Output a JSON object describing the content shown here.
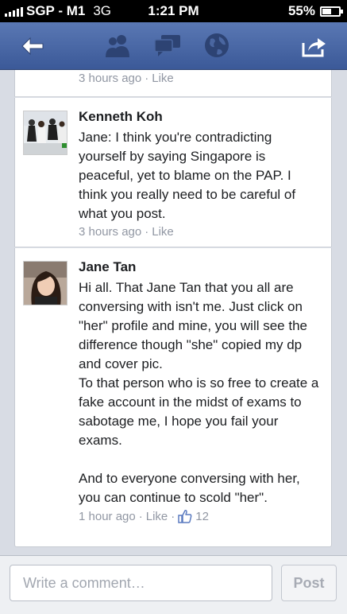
{
  "status_bar": {
    "carrier": "SGP - M1",
    "network": "3G",
    "time": "1:21 PM",
    "battery_text": "55%",
    "battery_level": 0.55
  },
  "nav": {
    "back_icon": "back-arrow-icon",
    "icons": [
      "friend-requests-icon",
      "messages-icon",
      "notifications-globe-icon"
    ],
    "share_icon": "share-icon",
    "bar_color": "#3b5998"
  },
  "top_comment": {
    "time": "3 hours ago",
    "like_label": "Like"
  },
  "comments": [
    {
      "author": "Kenneth Koh",
      "text": "Jane: I think you're contradicting yourself by saying Singapore is peaceful, yet to blame on the PAP. I think you really need to be careful of what you post.",
      "time": "3 hours ago",
      "like_label": "Like"
    },
    {
      "author": "Jane Tan",
      "text": "Hi all. That Jane Tan that you all are conversing with isn't me. Just click on \"her\" profile and mine, you will see the difference though \"she\" copied my dp and cover pic.\nTo that person who is so free to create a fake account in the midst of exams to sabotage me, I hope you fail your exams.\n\nAnd to everyone conversing with her, you can continue to scold \"her\".",
      "time": "1 hour ago",
      "like_label": "Like",
      "like_count": "12"
    }
  ],
  "composer": {
    "placeholder": "Write a comment…",
    "post_label": "Post"
  }
}
